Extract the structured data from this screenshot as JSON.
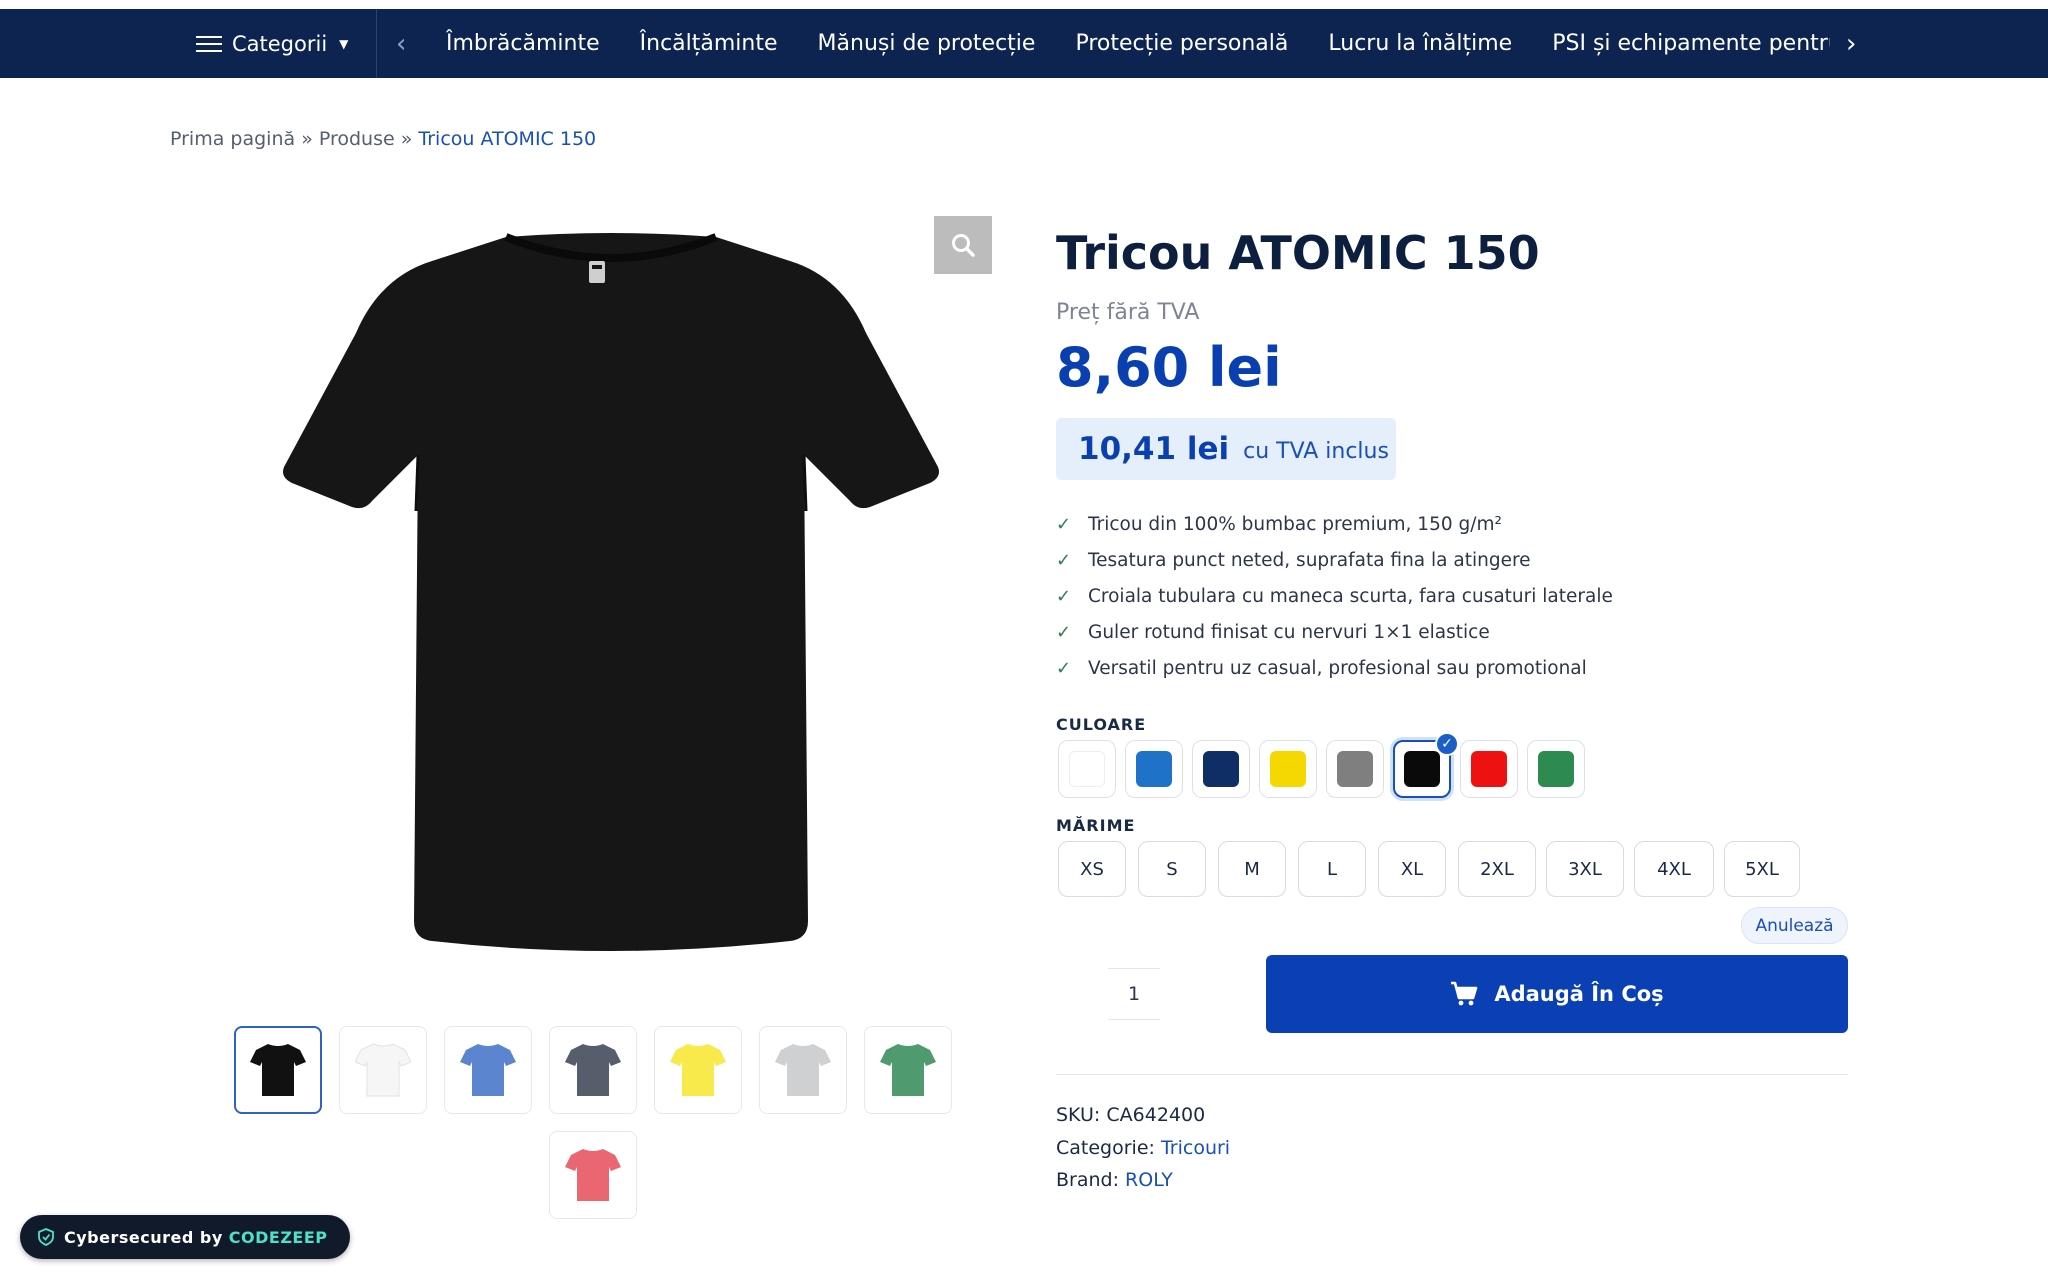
{
  "nav": {
    "categories_label": "Categorii",
    "links": [
      "Îmbrăcăminte",
      "Încălțăminte",
      "Mănuși de protecție",
      "Protecție personală",
      "Lucru la înălțime",
      "PSI și echipamente pentru pr"
    ]
  },
  "breadcrumb": {
    "home": "Prima pagină",
    "sep": "»",
    "products": "Produse",
    "current": "Tricou ATOMIC 150"
  },
  "product": {
    "title": "Tricou ATOMIC 150",
    "price_label": "Preț fără TVA",
    "price": "8,60 lei",
    "price_vat": "10,41 lei",
    "price_vat_label": "cu TVA inclus",
    "features": [
      "Tricou din 100% bumbac premium, 150 g/m²",
      "Tesatura punct neted, suprafata fina la atingere",
      "Croiala tubulara cu maneca scurta, fara cusaturi laterale",
      "Guler rotund finisat cu nervuri 1×1 elastice",
      "Versatil pentru uz casual, profesional sau promotional"
    ],
    "color_label": "CULOARE",
    "colors": [
      {
        "name": "white",
        "hex": "#ffffff"
      },
      {
        "name": "royal-blue",
        "hex": "#1e73c8"
      },
      {
        "name": "navy",
        "hex": "#0f2e66"
      },
      {
        "name": "yellow",
        "hex": "#f5d800"
      },
      {
        "name": "grey",
        "hex": "#7f7f7f"
      },
      {
        "name": "black",
        "hex": "#0a0a0a",
        "selected": true
      },
      {
        "name": "red",
        "hex": "#ee1111"
      },
      {
        "name": "green",
        "hex": "#2e8b4f"
      }
    ],
    "size_label": "MĂRIME",
    "sizes": [
      "XS",
      "S",
      "M",
      "L",
      "XL",
      "2XL",
      "3XL",
      "4XL",
      "5XL"
    ],
    "reset_label": "Anulează",
    "quantity": "1",
    "add_to_cart": "Adaugă În Coș",
    "sku_label": "SKU:",
    "sku": "CA642400",
    "category_label": "Categorie:",
    "category": "Tricouri",
    "brand_label": "Brand:",
    "brand": "ROLY"
  },
  "gallery": {
    "thumbs": [
      {
        "color": "#111111",
        "active": true
      },
      {
        "color": "#f6f6f6"
      },
      {
        "color": "#5b86cf"
      },
      {
        "color": "#565d6b"
      },
      {
        "color": "#f7ea4a"
      },
      {
        "color": "#cfd0d2"
      },
      {
        "color": "#4f9a6e"
      },
      {
        "color": "#ea6670"
      }
    ]
  },
  "badge": {
    "text": "Cybersecured by",
    "brand": "CODEZEEP"
  }
}
